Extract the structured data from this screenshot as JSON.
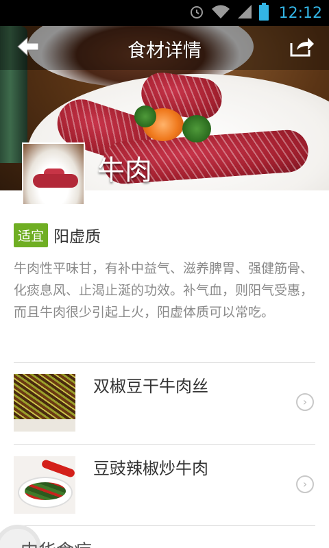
{
  "status_bar": {
    "time": "12:12",
    "icons": [
      "alarm-icon",
      "wifi-icon",
      "signal-icon",
      "battery-icon"
    ],
    "accent": "#33b5e5"
  },
  "header": {
    "title": "食材详情",
    "back_icon": "back-arrow-icon",
    "share_icon": "share-icon"
  },
  "ingredient": {
    "name": "牛肉"
  },
  "suitability": {
    "badge": "适宜",
    "badge_color": "#6fae23",
    "constitution": "阳虚质",
    "description": "牛肉性平味甘，有补中益气、滋养脾胃、强健筋骨、化痰息风、止渴止涎的功效。补气血，则阳气受惠，而且牛肉很少引起上火，阳虚体质可以常吃。"
  },
  "recipes": [
    {
      "name": "双椒豆干牛肉丝",
      "icon": "chevron-right-icon"
    },
    {
      "name": "豆豉辣椒炒牛肉",
      "icon": "chevron-right-icon"
    }
  ],
  "footer": {
    "partial_text": "中华食疗"
  }
}
